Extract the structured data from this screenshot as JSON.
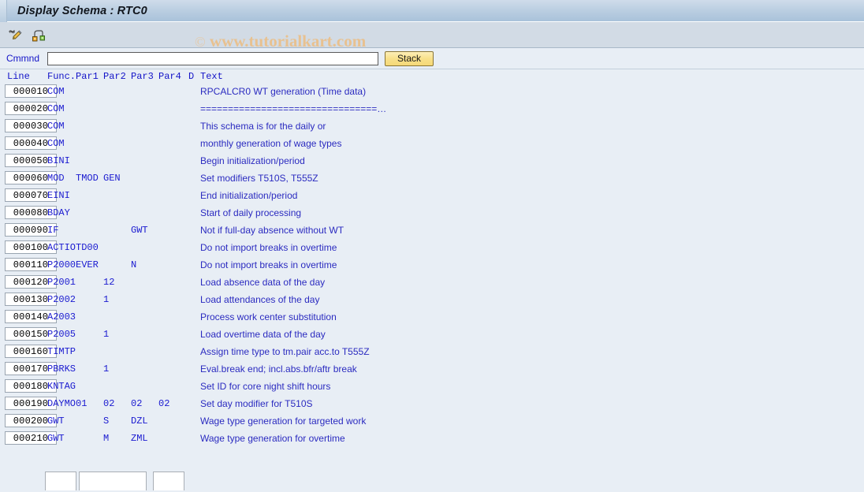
{
  "window": {
    "title": "Display Schema : RTC0"
  },
  "watermark": {
    "copyright": "©",
    "text": "www.tutorialkart.com"
  },
  "toolbar": {
    "icons": [
      {
        "name": "pencil-check-icon",
        "title": "Display <-> Change"
      },
      {
        "name": "schema-hierarchy-icon",
        "title": "Structure / Subschema"
      }
    ]
  },
  "command_bar": {
    "label": "Cmmnd",
    "input_value": "",
    "input_placeholder": "",
    "stack_label": "Stack"
  },
  "grid": {
    "headers": {
      "line": "Line",
      "func": "Func.",
      "par1": "Par1",
      "par2": "Par2",
      "par3": "Par3",
      "par4": "Par4",
      "d": "D",
      "text": "Text"
    },
    "rows": [
      {
        "line": "000010",
        "func": "COM",
        "par1": "",
        "par2": "",
        "par3": "",
        "par4": "",
        "d": "",
        "text": "RPCALCR0 WT generation (Time data)"
      },
      {
        "line": "000020",
        "func": "COM",
        "par1": "",
        "par2": "",
        "par3": "",
        "par4": "",
        "d": "",
        "text": "================================…"
      },
      {
        "line": "000030",
        "func": "COM",
        "par1": "",
        "par2": "",
        "par3": "",
        "par4": "",
        "d": "",
        "text": "This schema is for the daily or"
      },
      {
        "line": "000040",
        "func": "COM",
        "par1": "",
        "par2": "",
        "par3": "",
        "par4": "",
        "d": "",
        "text": "monthly generation of wage types"
      },
      {
        "line": "000050",
        "func": "BINI",
        "par1": "",
        "par2": "",
        "par3": "",
        "par4": "",
        "d": "",
        "text": "Begin initialization/period"
      },
      {
        "line": "000060",
        "func": "MOD",
        "par1": "TMOD",
        "par2": "GEN",
        "par3": "",
        "par4": "",
        "d": "",
        "text": "Set modifiers T510S, T555Z"
      },
      {
        "line": "000070",
        "func": "EINI",
        "par1": "",
        "par2": "",
        "par3": "",
        "par4": "",
        "d": "",
        "text": "End initialization/period"
      },
      {
        "line": "000080",
        "func": "BDAY",
        "par1": "",
        "par2": "",
        "par3": "",
        "par4": "",
        "d": "",
        "text": "Start of daily processing"
      },
      {
        "line": "000090",
        "func": "IF",
        "par1": "",
        "par2": "",
        "par3": "GWT",
        "par4": "",
        "d": "",
        "text": "Not if full-day absence without WT"
      },
      {
        "line": "000100",
        "func": "ACTIO",
        "par1": "TD00",
        "par2": "",
        "par3": "",
        "par4": "",
        "d": "",
        "text": "Do not import breaks in overtime"
      },
      {
        "line": "000110",
        "func": "P2000",
        "par1": "EVER",
        "par2": "",
        "par3": "N",
        "par4": "",
        "d": "",
        "text": "Do not import breaks in overtime"
      },
      {
        "line": "000120",
        "func": "P2001",
        "par1": "",
        "par2": "12",
        "par3": "",
        "par4": "",
        "d": "",
        "text": "Load absence data of the day"
      },
      {
        "line": "000130",
        "func": "P2002",
        "par1": "",
        "par2": "1",
        "par3": "",
        "par4": "",
        "d": "",
        "text": "Load attendances of the day"
      },
      {
        "line": "000140",
        "func": "A2003",
        "par1": "",
        "par2": "",
        "par3": "",
        "par4": "",
        "d": "",
        "text": "Process work center substitution"
      },
      {
        "line": "000150",
        "func": "P2005",
        "par1": "",
        "par2": "1",
        "par3": "",
        "par4": "",
        "d": "",
        "text": "Load overtime data of the day"
      },
      {
        "line": "000160",
        "func": "TIMTP",
        "par1": "",
        "par2": "",
        "par3": "",
        "par4": "",
        "d": "",
        "text": "Assign time type to tm.pair acc.to T555Z"
      },
      {
        "line": "000170",
        "func": "PBRKS",
        "par1": "",
        "par2": "1",
        "par3": "",
        "par4": "",
        "d": "",
        "text": "Eval.break end; incl.abs.bfr/aftr break"
      },
      {
        "line": "000180",
        "func": "KNTAG",
        "par1": "",
        "par2": "",
        "par3": "",
        "par4": "",
        "d": "",
        "text": "Set ID for core night shift hours"
      },
      {
        "line": "000190",
        "func": "DAYMO",
        "par1": "01",
        "par2": "02",
        "par3": "02",
        "par4": "02",
        "d": "",
        "text": "Set day modifier for T510S"
      },
      {
        "line": "000200",
        "func": "GWT",
        "par1": "",
        "par2": "S",
        "par3": "DZL",
        "par4": "",
        "d": "",
        "text": "Wage type generation for targeted work"
      },
      {
        "line": "000210",
        "func": "GWT",
        "par1": "",
        "par2": "M",
        "par3": "ZML",
        "par4": "",
        "d": "",
        "text": "Wage type generation for overtime"
      }
    ]
  },
  "colors": {
    "title_bar": "#bccfe2",
    "toolbar": "#d2dbe5",
    "content": "#e8eef5",
    "text_blue": "#1a1ad0",
    "label_blue": "#1414c8",
    "stack_button": "#f8e08a",
    "watermark": "#e8c190"
  }
}
